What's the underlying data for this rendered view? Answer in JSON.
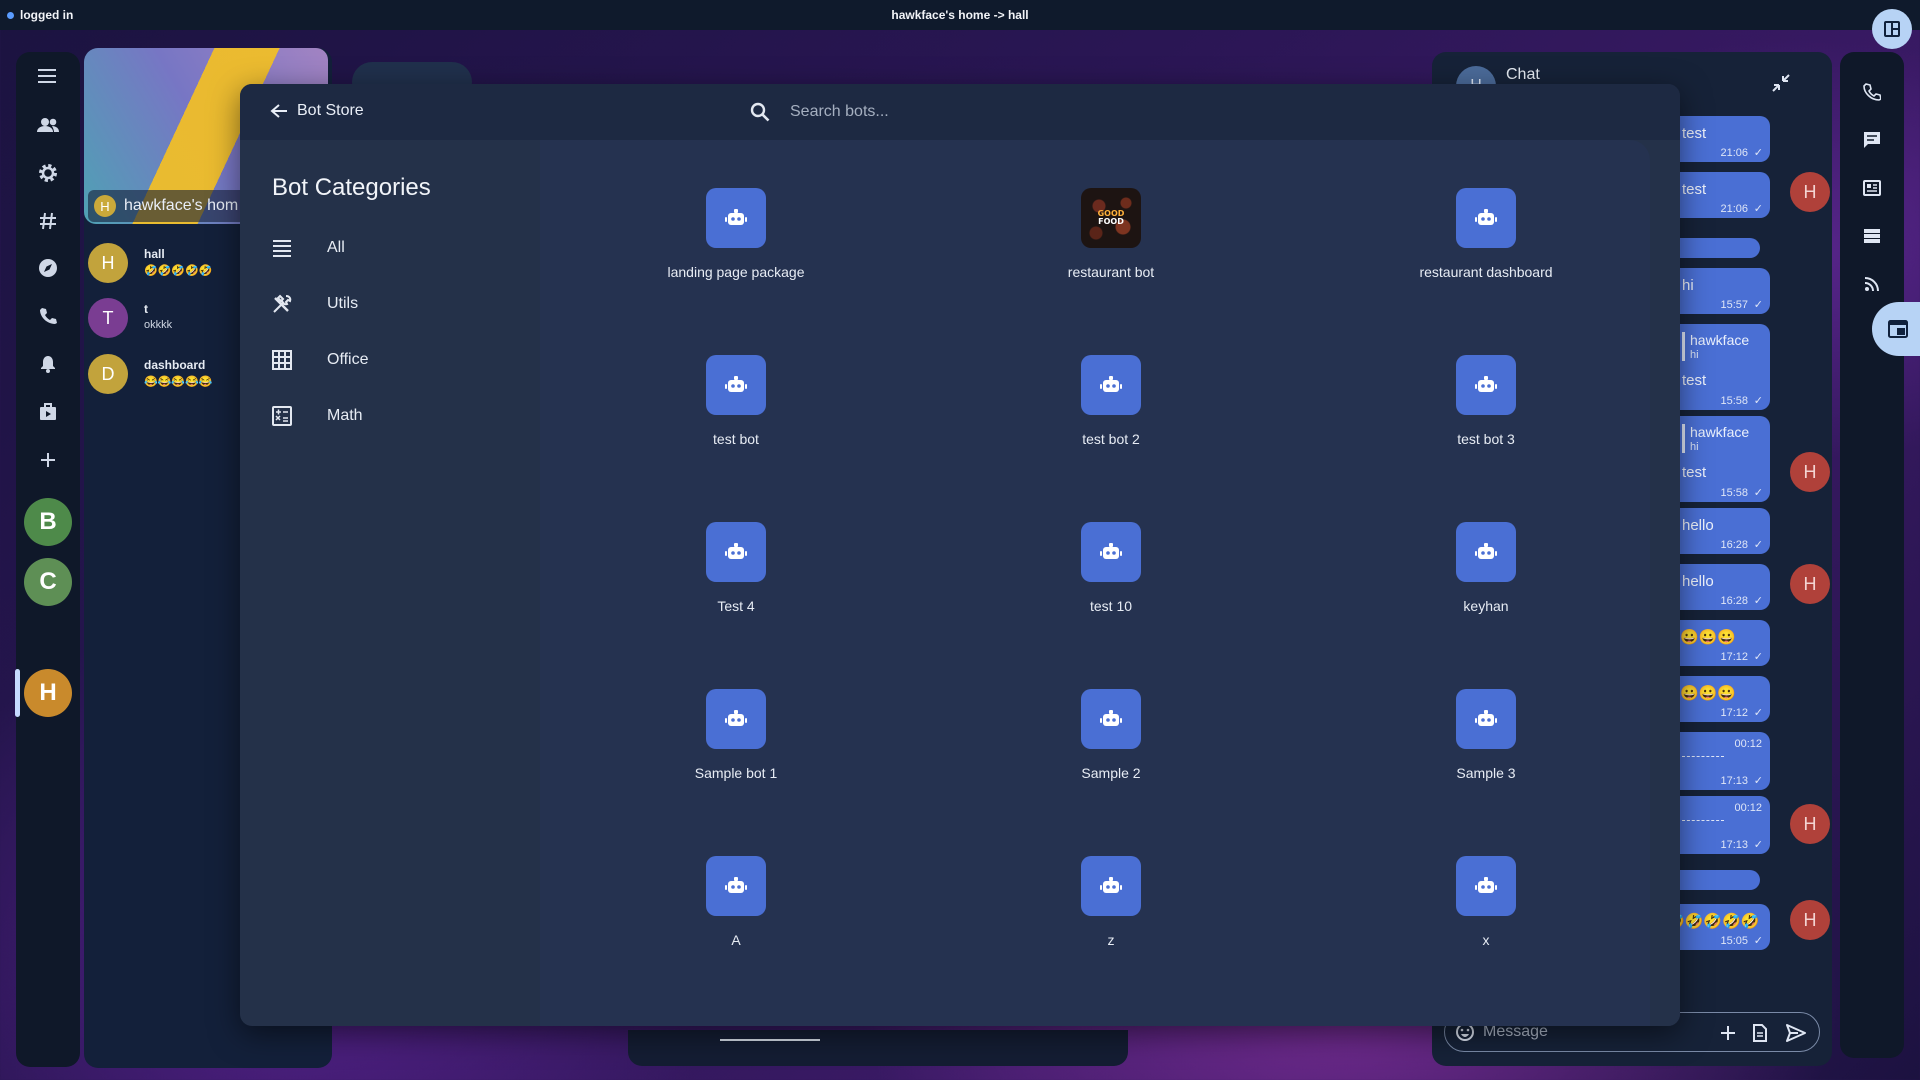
{
  "topbar": {
    "status": "logged in",
    "title": "hawkface's home -> hall"
  },
  "left_rail": {
    "icons": [
      "menu-icon",
      "people-icon",
      "settings-icon",
      "hash-icon",
      "compass-icon",
      "phone-icon",
      "bell-icon",
      "shopping-bag-icon",
      "plus-icon"
    ],
    "avatars": [
      {
        "letter": "B",
        "color": "#4e8a4a"
      },
      {
        "letter": "C",
        "color": "#5e8f55"
      },
      {
        "letter": "H",
        "color": "#c98a2c"
      }
    ]
  },
  "room_panel": {
    "banner_name": "hawkface's hom",
    "banner_letter": "H",
    "rooms": [
      {
        "letter": "H",
        "name": "hall",
        "message": "🤣🤣🤣🤣🤣",
        "color": "#c2a33c"
      },
      {
        "letter": "T",
        "name": "t",
        "message": "okkkk",
        "color": "#7a3d92"
      },
      {
        "letter": "D",
        "name": "dashboard",
        "message": "😂😂😂😂😂",
        "color": "#c2a33c"
      }
    ]
  },
  "modal": {
    "back_label": "Bot Store",
    "search_placeholder": "Search bots...",
    "categories_title": "Bot Categories",
    "categories": [
      {
        "label": "All",
        "icon": "list-icon"
      },
      {
        "label": "Utils",
        "icon": "tools-icon"
      },
      {
        "label": "Office",
        "icon": "grid-icon"
      },
      {
        "label": "Math",
        "icon": "calculator-icon"
      }
    ],
    "bots": [
      {
        "label": "landing page package",
        "icon": "robot-icon"
      },
      {
        "label": "restaurant bot",
        "icon": "good-food-image"
      },
      {
        "label": "restaurant dashboard",
        "icon": "robot-icon"
      },
      {
        "label": "test bot",
        "icon": "robot-icon"
      },
      {
        "label": "test bot 2",
        "icon": "robot-icon"
      },
      {
        "label": "test bot 3",
        "icon": "robot-icon"
      },
      {
        "label": "Test 4",
        "icon": "robot-icon"
      },
      {
        "label": "test 10",
        "icon": "robot-icon"
      },
      {
        "label": "keyhan",
        "icon": "robot-icon"
      },
      {
        "label": "Sample bot 1",
        "icon": "robot-icon"
      },
      {
        "label": "Sample 2",
        "icon": "robot-icon"
      },
      {
        "label": "Sample 3",
        "icon": "robot-icon"
      },
      {
        "label": "A",
        "icon": "robot-icon"
      },
      {
        "label": "z",
        "icon": "robot-icon"
      },
      {
        "label": "x",
        "icon": "robot-icon"
      }
    ],
    "restaurant_image_text": {
      "line1": "GOOD",
      "line2": "FOOD"
    }
  },
  "chat": {
    "title": "Chat",
    "header_avatar": "H",
    "sender_avatar": "H",
    "input_placeholder": "Message",
    "messages": {
      "m1": {
        "text": "test",
        "time": "21:06"
      },
      "m2": {
        "text": "test",
        "time": "21:06"
      },
      "m3": {
        "text": "hi",
        "time": "15:57"
      },
      "m4": {
        "quote_name": "hawkface",
        "quote_msg": "hi",
        "text": "test",
        "time": "15:58"
      },
      "m5": {
        "quote_name": "hawkface",
        "quote_msg": "hi",
        "text": "test",
        "time": "15:58"
      },
      "m6": {
        "text": "hello",
        "time": "16:28"
      },
      "m7": {
        "text": "hello",
        "time": "16:28"
      },
      "m8": {
        "text": "😀😀😀",
        "time": "17:12"
      },
      "m9": {
        "text": "😀😀😀",
        "time": "17:12"
      },
      "m10": {
        "duration": "00:12",
        "time": "17:13"
      },
      "m11": {
        "duration": "00:12",
        "time": "17:13"
      },
      "m12": {
        "text": "🤣🤣🤣🤣🤣",
        "time": "15:05"
      }
    }
  },
  "right_rail": {
    "icons": [
      "phone-icon",
      "chat-icon",
      "newspaper-icon",
      "storage-icon",
      "rss-icon",
      "window-icon"
    ]
  },
  "colors": {
    "accent": "#4a6fd4",
    "modal_bg": "#243149",
    "panel_bg": "#162238"
  }
}
